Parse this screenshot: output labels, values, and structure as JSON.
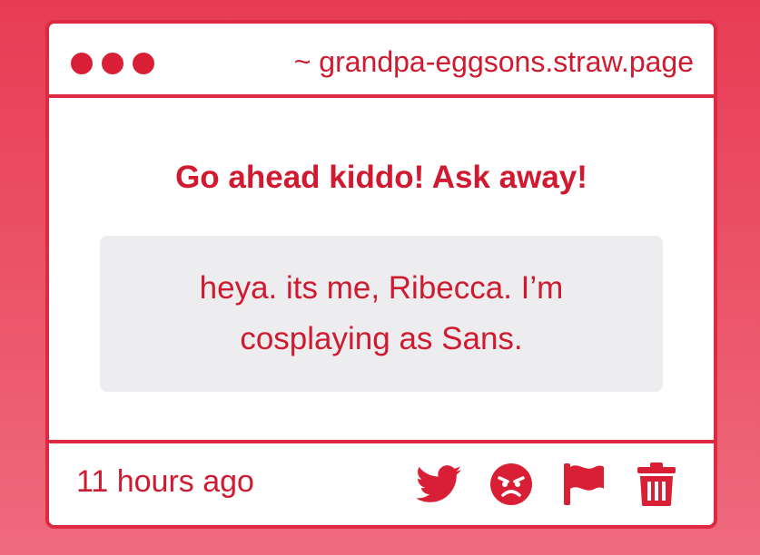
{
  "window": {
    "url": "~ grandpa-eggsons.straw.page"
  },
  "content": {
    "prompt": "Go ahead kiddo! Ask away!",
    "question": "heya. its me, Ribecca. I’m cosplaying as Sans."
  },
  "footer": {
    "timestamp": "11 hours ago",
    "actions": [
      "twitter-icon",
      "angry-face-icon",
      "flag-icon",
      "trash-icon"
    ]
  },
  "colors": {
    "accent": "#d11a2f",
    "border": "#dd2a42",
    "background_top": "#e83c54",
    "background_bottom": "#ef6a7d",
    "question_bg": "#edecee"
  }
}
